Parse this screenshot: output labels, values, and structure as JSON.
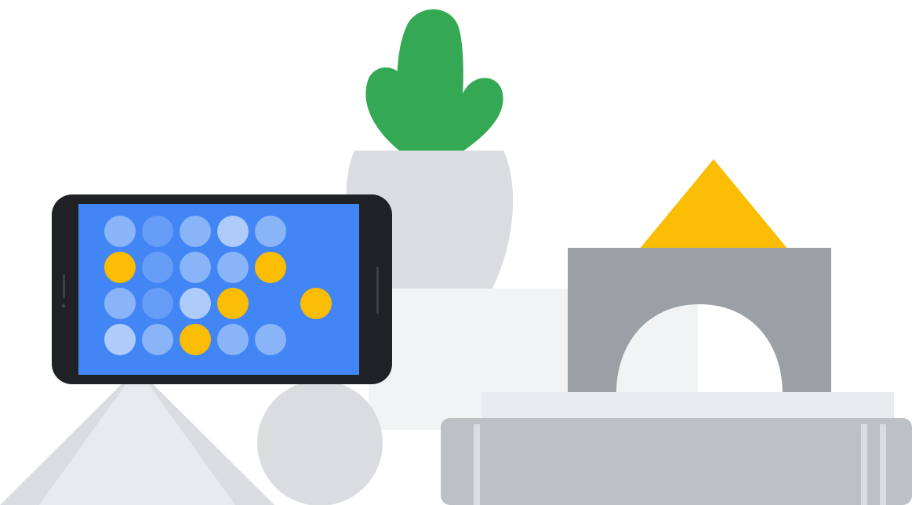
{
  "illustration": {
    "colors": {
      "background": "#ffffff",
      "plant_green": "#34a853",
      "pot_gray": "#dadce0",
      "shelf_light": "#f1f3f4",
      "phone_body": "#202124",
      "screen_blue": "#4285f4",
      "dot_light": "#aecbfa",
      "dot_mid": "#8ab4f8",
      "dot_dark": "#669df6",
      "dot_yellow": "#fbbc04",
      "arch_gray": "#9aa0a6",
      "book_gray": "#bdc1c6",
      "book_top": "#e8eaed",
      "triangle_yellow": "#fbbc04"
    },
    "objects": [
      "plant-in-pot",
      "phone-landscape",
      "stand-triangle",
      "stand-sphere",
      "arch-block",
      "yellow-triangle-block",
      "book-stack"
    ],
    "phone_screen_dots": {
      "rows": [
        [
          "mid",
          "dark",
          "mid",
          "light",
          "mid"
        ],
        [
          "yellow",
          "dark",
          "mid",
          "mid",
          "yellow"
        ],
        [
          "mid",
          "dark",
          "light",
          "yellow",
          "none",
          "yellow"
        ],
        [
          "light",
          "mid",
          "yellow",
          "mid",
          "mid"
        ]
      ]
    }
  }
}
